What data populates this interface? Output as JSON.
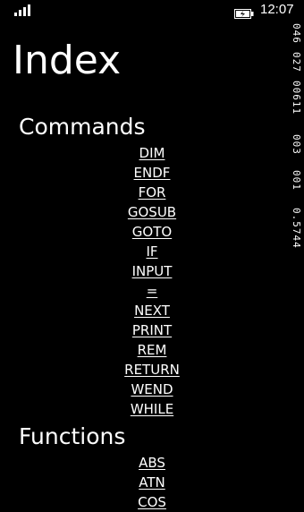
{
  "status_bar": {
    "signal_icon": "signal-strength-icon",
    "battery_icon": "battery-charging-icon",
    "time": "12:07"
  },
  "title": "Index",
  "side_counters": [
    "046",
    "027",
    "00611",
    "003",
    "001",
    "0.5744"
  ],
  "sections": [
    {
      "header": "Commands",
      "links": [
        "DIM",
        "ENDF",
        "FOR",
        "GOSUB",
        "GOTO",
        "IF",
        "INPUT",
        "=",
        "NEXT",
        "PRINT",
        "REM",
        "RETURN",
        "WEND",
        "WHILE"
      ]
    },
    {
      "header": "Functions",
      "links": [
        "ABS",
        "ATN",
        "COS"
      ]
    }
  ]
}
